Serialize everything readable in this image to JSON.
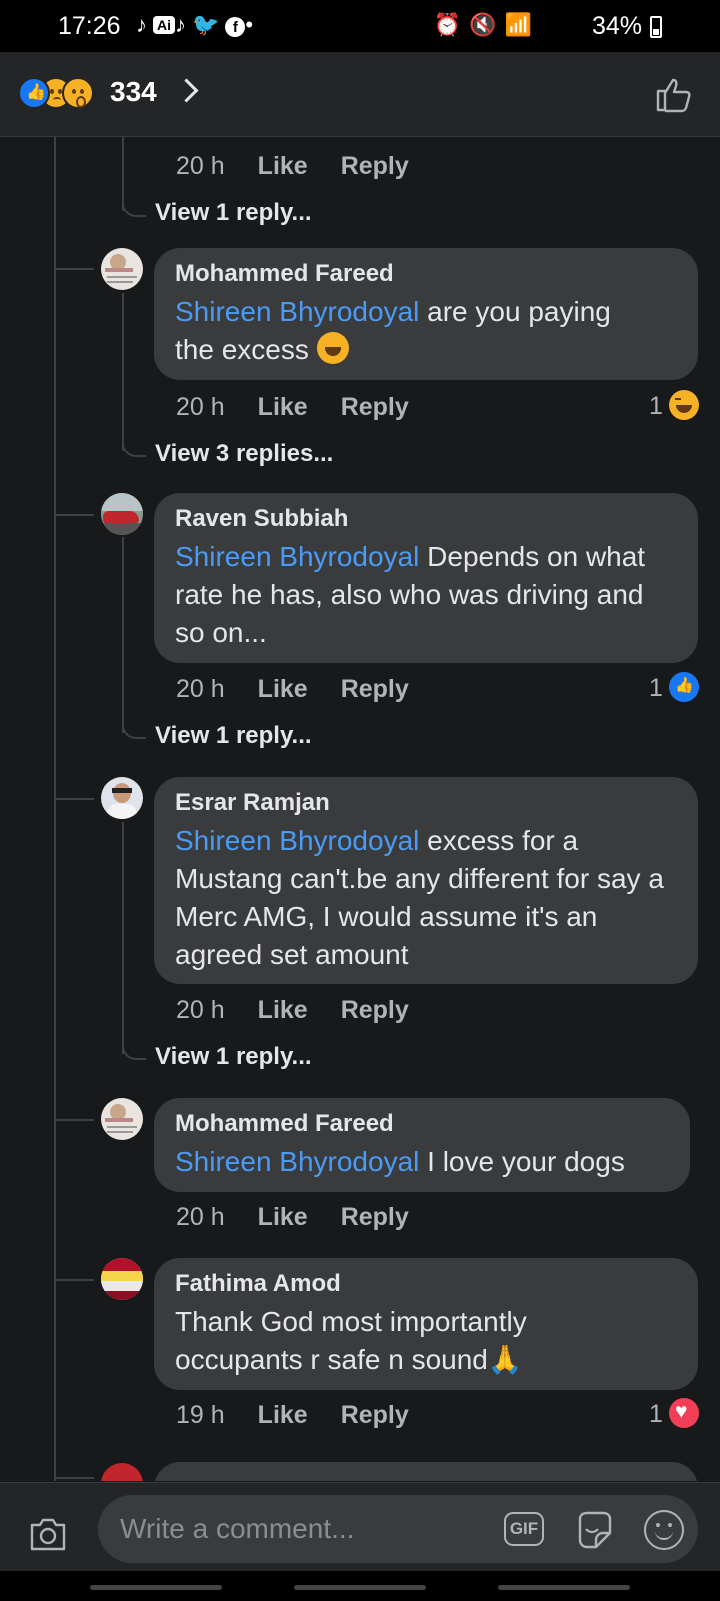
{
  "status_bar": {
    "time": "17:26",
    "left_icons": [
      "tiktok-icon",
      "ai-icon",
      "tiktok-icon",
      "twitter-icon",
      "facebook-icon",
      "dot-icon"
    ],
    "battery": "34%"
  },
  "header": {
    "reaction_types": [
      "like",
      "sad",
      "wow"
    ],
    "reaction_count": "334"
  },
  "comments": [
    {
      "time": "20 h",
      "like": "Like",
      "reply": "Reply",
      "view_replies": "View 1 reply..."
    },
    {
      "name": "Mohammed Fareed",
      "mention": "Shireen Bhyrodoyal",
      "text_a": " are you paying",
      "text_b": "the excess",
      "emoji": "haha",
      "time": "20 h",
      "like": "Like",
      "reply": "Reply",
      "reaction_count": "1",
      "reaction_type": "haha",
      "view_replies": "View 3 replies..."
    },
    {
      "name": "Raven Subbiah",
      "mention": "Shireen Bhyrodoyal",
      "text": " Depends on what rate he has, also who was driving and so on...",
      "time": "20 h",
      "like": "Like",
      "reply": "Reply",
      "reaction_count": "1",
      "reaction_type": "like",
      "view_replies": "View 1 reply..."
    },
    {
      "name": "Esrar Ramjan",
      "mention": "Shireen Bhyrodoyal",
      "text": " excess for a Mustang can't.be any different for say a Merc AMG, I would assume it's an agreed set amount",
      "time": "20 h",
      "like": "Like",
      "reply": "Reply",
      "view_replies": "View 1 reply..."
    },
    {
      "name": "Mohammed Fareed",
      "mention": "Shireen Bhyrodoyal",
      "text": " I love your dogs",
      "time": "20 h",
      "like": "Like",
      "reply": "Reply"
    },
    {
      "name": "Fathima Amod",
      "text_a": "Thank God most importantly",
      "text_b": "occupants r safe n sound",
      "emoji": "pray",
      "time": "19 h",
      "like": "Like",
      "reply": "Reply",
      "reaction_count": "1",
      "reaction_type": "love"
    }
  ],
  "composer": {
    "placeholder": "Write a comment...",
    "gif_label": "GIF"
  },
  "colors": {
    "background": "#18191a",
    "bubble": "#3a3b3c",
    "mention": "#4b9bf5",
    "like_blue": "#1877f2",
    "love_red": "#f33e58",
    "haha_yellow": "#f7b125"
  }
}
